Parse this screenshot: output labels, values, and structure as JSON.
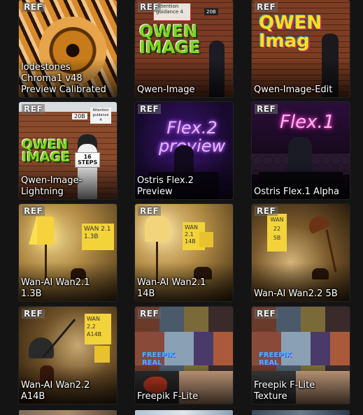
{
  "badge_text": "REF",
  "tiles": [
    {
      "label": "lodestones\nChroma1 v48\nPreview Calibrated"
    },
    {
      "label": "Qwen-Image",
      "sign1": "Attention\nguidance 4",
      "sign2": "20B",
      "art": "QWEN\nIMAGE"
    },
    {
      "label": "Qwen-Image-Edit",
      "art": "QWEN\nImag"
    },
    {
      "label": "Qwen-Image-\nLightning",
      "sign1": "20B",
      "sign2": "Attention\nguidance\n4",
      "art": "QWEN\nIMAGE",
      "card": "16\nSTEPS"
    },
    {
      "label": "Ostris Flex.2\nPreview",
      "art": "Flex.2\npreview"
    },
    {
      "label": "Ostris Flex.1 Alpha",
      "art": "Flex.1"
    },
    {
      "label": "Wan-AI Wan2.1\n1.3B",
      "note": "WAN 2.1\n1.3B"
    },
    {
      "label": "Wan-AI Wan2.1\n14B",
      "note": "WAN\n2.1\n14B"
    },
    {
      "label": "Wan-AI Wan2.2 5B",
      "note": "WAN\n22\n5B"
    },
    {
      "label": "Wan-AI Wan2.2\nA14B",
      "note": "WAN\n2.2\nA14B"
    },
    {
      "label": "Freepik F-Lite",
      "art": "FREEPIK\nREAL"
    },
    {
      "label": "Freepik F-Lite\nTexture",
      "art": "FREEPIK\nREAL"
    }
  ],
  "colors": {
    "background": "#141414",
    "qwen_green": "#7ed321",
    "flex_purple": "#c77dff",
    "flex_pink": "#ff4fd8",
    "note_yellow": "#f2d33a"
  }
}
